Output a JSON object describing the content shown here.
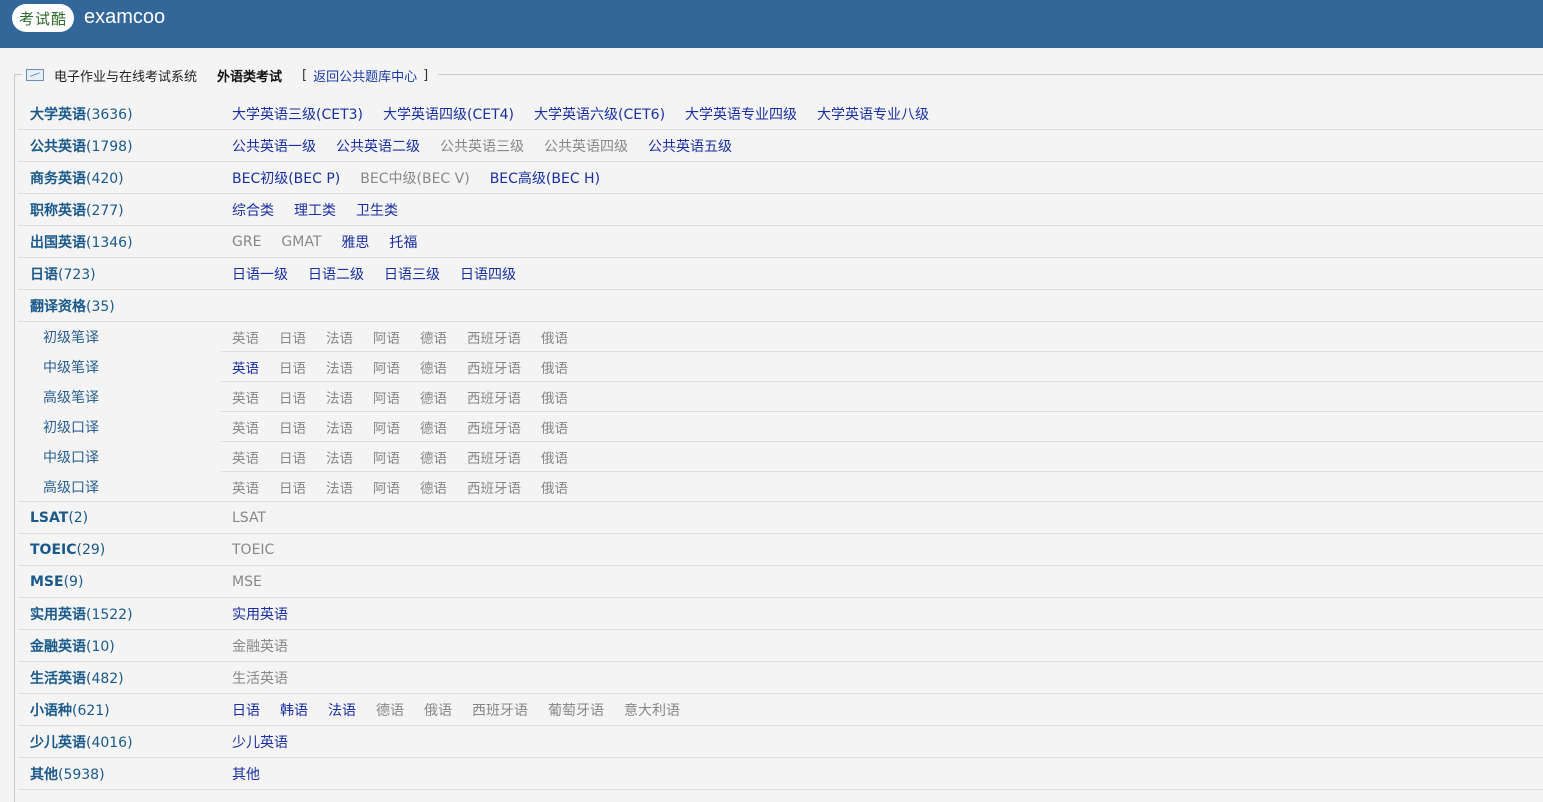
{
  "header": {
    "logo_text": "考试酷",
    "site_name": "examcoo"
  },
  "breadcrumb": {
    "system": "电子作业与在线考试系统",
    "current": "外语类考试",
    "open": "[",
    "link": "返回公共题库中心",
    "close": "]"
  },
  "rows": [
    {
      "name": "大学英语",
      "count": "(3636)",
      "items": [
        {
          "label": "大学英语三级(CET3)",
          "active": true
        },
        {
          "label": "大学英语四级(CET4)",
          "active": true
        },
        {
          "label": "大学英语六级(CET6)",
          "active": true
        },
        {
          "label": "大学英语专业四级",
          "active": true
        },
        {
          "label": "大学英语专业八级",
          "active": true
        }
      ]
    },
    {
      "name": "公共英语",
      "count": "(1798)",
      "items": [
        {
          "label": "公共英语一级",
          "active": true
        },
        {
          "label": "公共英语二级",
          "active": true
        },
        {
          "label": "公共英语三级",
          "active": false
        },
        {
          "label": "公共英语四级",
          "active": false
        },
        {
          "label": "公共英语五级",
          "active": true
        }
      ]
    },
    {
      "name": "商务英语",
      "count": "(420)",
      "items": [
        {
          "label": "BEC初级(BEC P)",
          "active": true
        },
        {
          "label": "BEC中级(BEC V)",
          "active": false
        },
        {
          "label": "BEC高级(BEC H)",
          "active": true
        }
      ]
    },
    {
      "name": "职称英语",
      "count": "(277)",
      "items": [
        {
          "label": "综合类",
          "active": true
        },
        {
          "label": "理工类",
          "active": true
        },
        {
          "label": "卫生类",
          "active": true
        }
      ]
    },
    {
      "name": "出国英语",
      "count": "(1346)",
      "items": [
        {
          "label": "GRE",
          "active": false
        },
        {
          "label": "GMAT",
          "active": false
        },
        {
          "label": "雅思",
          "active": true
        },
        {
          "label": "托福",
          "active": true
        }
      ]
    },
    {
      "name": "日语",
      "count": "(723)",
      "items": [
        {
          "label": "日语一级",
          "active": true
        },
        {
          "label": "日语二级",
          "active": true
        },
        {
          "label": "日语三级",
          "active": true
        },
        {
          "label": "日语四级",
          "active": true
        }
      ]
    },
    {
      "name": "翻译资格",
      "count": "(35)",
      "items": []
    },
    {
      "name": "初级笔译",
      "count": "",
      "sub": true,
      "items": [
        {
          "label": "英语",
          "active": false
        },
        {
          "label": "日语",
          "active": false
        },
        {
          "label": "法语",
          "active": false
        },
        {
          "label": "阿语",
          "active": false
        },
        {
          "label": "德语",
          "active": false
        },
        {
          "label": "西班牙语",
          "active": false
        },
        {
          "label": "俄语",
          "active": false
        }
      ]
    },
    {
      "name": "中级笔译",
      "count": "",
      "sub": true,
      "items": [
        {
          "label": "英语",
          "active": true
        },
        {
          "label": "日语",
          "active": false
        },
        {
          "label": "法语",
          "active": false
        },
        {
          "label": "阿语",
          "active": false
        },
        {
          "label": "德语",
          "active": false
        },
        {
          "label": "西班牙语",
          "active": false
        },
        {
          "label": "俄语",
          "active": false
        }
      ]
    },
    {
      "name": "高级笔译",
      "count": "",
      "sub": true,
      "items": [
        {
          "label": "英语",
          "active": false
        },
        {
          "label": "日语",
          "active": false
        },
        {
          "label": "法语",
          "active": false
        },
        {
          "label": "阿语",
          "active": false
        },
        {
          "label": "德语",
          "active": false
        },
        {
          "label": "西班牙语",
          "active": false
        },
        {
          "label": "俄语",
          "active": false
        }
      ]
    },
    {
      "name": "初级口译",
      "count": "",
      "sub": true,
      "items": [
        {
          "label": "英语",
          "active": false
        },
        {
          "label": "日语",
          "active": false
        },
        {
          "label": "法语",
          "active": false
        },
        {
          "label": "阿语",
          "active": false
        },
        {
          "label": "德语",
          "active": false
        },
        {
          "label": "西班牙语",
          "active": false
        },
        {
          "label": "俄语",
          "active": false
        }
      ]
    },
    {
      "name": "中级口译",
      "count": "",
      "sub": true,
      "items": [
        {
          "label": "英语",
          "active": false
        },
        {
          "label": "日语",
          "active": false
        },
        {
          "label": "法语",
          "active": false
        },
        {
          "label": "阿语",
          "active": false
        },
        {
          "label": "德语",
          "active": false
        },
        {
          "label": "西班牙语",
          "active": false
        },
        {
          "label": "俄语",
          "active": false
        }
      ]
    },
    {
      "name": "高级口译",
      "count": "",
      "sub": true,
      "last": true,
      "items": [
        {
          "label": "英语",
          "active": false
        },
        {
          "label": "日语",
          "active": false
        },
        {
          "label": "法语",
          "active": false
        },
        {
          "label": "阿语",
          "active": false
        },
        {
          "label": "德语",
          "active": false
        },
        {
          "label": "西班牙语",
          "active": false
        },
        {
          "label": "俄语",
          "active": false
        }
      ]
    },
    {
      "name": "LSAT",
      "count": "(2)",
      "items": [
        {
          "label": "LSAT",
          "active": false
        }
      ]
    },
    {
      "name": "TOEIC",
      "count": "(29)",
      "items": [
        {
          "label": "TOEIC",
          "active": false
        }
      ]
    },
    {
      "name": "MSE",
      "count": "(9)",
      "items": [
        {
          "label": "MSE",
          "active": false
        }
      ]
    },
    {
      "name": "实用英语",
      "count": "(1522)",
      "items": [
        {
          "label": "实用英语",
          "active": true
        }
      ]
    },
    {
      "name": "金融英语",
      "count": "(10)",
      "items": [
        {
          "label": "金融英语",
          "active": false
        }
      ]
    },
    {
      "name": "生活英语",
      "count": "(482)",
      "items": [
        {
          "label": "生活英语",
          "active": false
        }
      ]
    },
    {
      "name": "小语种",
      "count": "(621)",
      "items": [
        {
          "label": "日语",
          "active": true
        },
        {
          "label": "韩语",
          "active": true
        },
        {
          "label": "法语",
          "active": true
        },
        {
          "label": "德语",
          "active": false
        },
        {
          "label": "俄语",
          "active": false
        },
        {
          "label": "西班牙语",
          "active": false
        },
        {
          "label": "葡萄牙语",
          "active": false
        },
        {
          "label": "意大利语",
          "active": false
        }
      ]
    },
    {
      "name": "少儿英语",
      "count": "(4016)",
      "items": [
        {
          "label": "少儿英语",
          "active": true
        }
      ]
    },
    {
      "name": "其他",
      "count": "(5938)",
      "items": [
        {
          "label": "其他",
          "active": true
        }
      ]
    }
  ],
  "colors": {
    "header_bg": "#336699",
    "link_active": "#1a2fa0",
    "link_inactive": "#888888",
    "category": "#1a5a8a"
  }
}
